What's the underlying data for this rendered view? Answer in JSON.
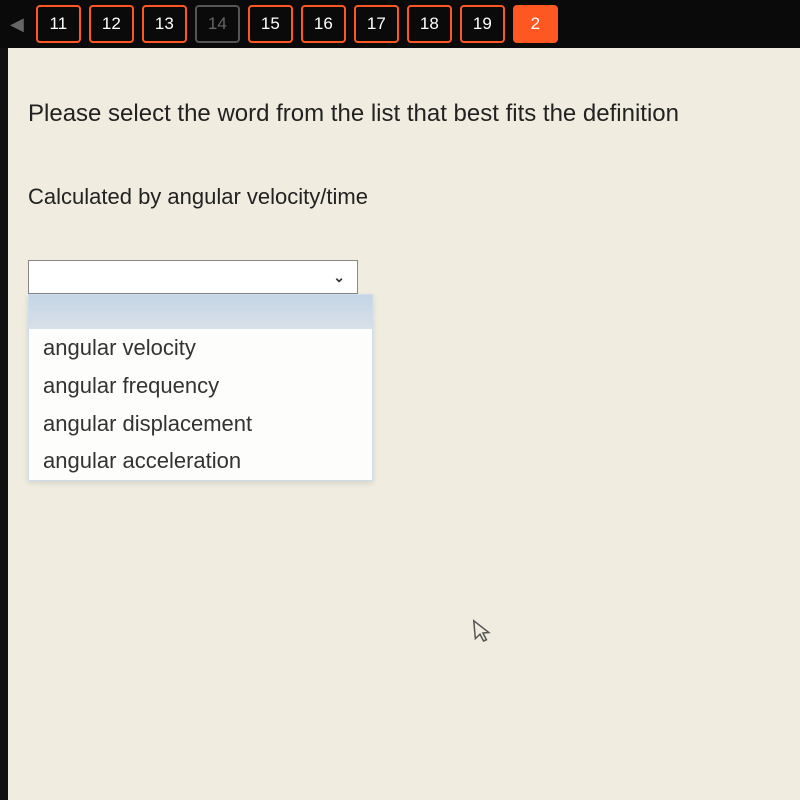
{
  "nav": {
    "tabs": [
      "11",
      "12",
      "13",
      "14",
      "15",
      "16",
      "17",
      "18",
      "19",
      "2"
    ],
    "disabled_index": 3,
    "active_index": 9
  },
  "question": {
    "prompt": "Please select the word from the list that best fits the definition",
    "definition": "Calculated by angular velocity/time"
  },
  "dropdown": {
    "selected": "",
    "options": [
      "angular velocity",
      "angular frequency",
      "angular displacement",
      "angular acceleration"
    ]
  }
}
